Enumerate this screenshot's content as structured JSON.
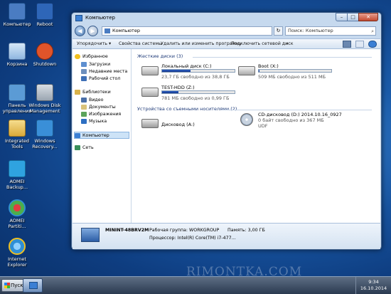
{
  "desktop": {
    "icons": [
      {
        "label": "Компьютер",
        "icon": "computer-icon",
        "color": "#4a7cc2"
      },
      {
        "label": "Reboot",
        "icon": "reboot-icon",
        "color": "#2e66b8"
      },
      {
        "label": "Корзина",
        "icon": "recycle-bin-icon",
        "color": "#8fb7e0"
      },
      {
        "label": "Shutdown",
        "icon": "shutdown-icon",
        "color": "#e0542a"
      },
      {
        "label": "Панель управления",
        "icon": "control-panel-icon",
        "color": "#5b9bd5"
      },
      {
        "label": "Windows Disk Management",
        "icon": "disk-management-icon",
        "color": "#9aa5b1"
      },
      {
        "label": "Integrated Tools",
        "icon": "folder-icon",
        "color": "#e8c66a"
      },
      {
        "label": "Windows Recovery...",
        "icon": "windows-recovery-icon",
        "color": "#3a8fd8"
      },
      {
        "label": "AOMEI Backup...",
        "icon": "aomei-backupper-icon",
        "color": "#2fa3e0"
      },
      {
        "label": "AOMEI Partiti...",
        "icon": "aomei-partition-icon",
        "color": "#4cae4c"
      },
      {
        "label": "Internet Explorer",
        "icon": "internet-explorer-icon",
        "color": "#2f8fd6"
      }
    ]
  },
  "window": {
    "title": "Компьютер",
    "controls": {
      "min": "–",
      "max": "□",
      "close": "✕"
    },
    "address": "Компьютер",
    "search_placeholder": "Поиск: Компьютер",
    "toolbar": {
      "organize": "Упорядочить ▾",
      "properties": "Свойства системы",
      "uninstall": "Удалить или изменить программу",
      "map_drive": "Подключить сетевой диск",
      "more": "»"
    },
    "nav": {
      "favorites": "Избранное",
      "downloads": "Загрузки",
      "recent": "Недавние места",
      "desktop": "Рабочий стол",
      "libraries": "Библиотеки",
      "video": "Видео",
      "documents": "Документы",
      "images": "Изображения",
      "music": "Музыка",
      "computer": "Компьютер",
      "network": "Сеть"
    },
    "groups": {
      "hard_disks": "Жесткие диски (3)",
      "removable": "Устройства со съемными носителями (2)"
    },
    "drives": [
      {
        "name": "Локальный диск (C:)",
        "free": "23,7 ГБ свободно из 38,8 ГБ",
        "used_fraction": 0.39
      },
      {
        "name": "Boot (X:)",
        "free": "509 МБ свободно из 511 МБ",
        "used_fraction": 0.01
      },
      {
        "name": "TEST-HDD (Z:)",
        "free": "781 МБ свободно из 0,99 ГБ",
        "used_fraction": 0.23
      }
    ],
    "removable": [
      {
        "name": "Дисковод (A:)",
        "line2": "",
        "line3": ""
      },
      {
        "name": "CD-дисковод (D:) 2014.10.16_0927",
        "line2": "0 байт свободно из 367 МБ",
        "line3": "UDF"
      }
    ],
    "details": {
      "pc_name": "MININT-48BRV2M",
      "workgroup": "Рабочая группа: WORKGROUP",
      "memory": "Память: 3,00 ГБ",
      "cpu": "Процессор: Intel(R) Core(TM) i7-477..."
    }
  },
  "taskbar": {
    "start": "Пуск",
    "time": "9:34",
    "date": "16.10.2014"
  },
  "watermark": "RIMONTKA.COM"
}
